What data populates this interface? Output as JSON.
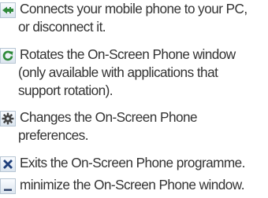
{
  "items": [
    {
      "icon": "connect-icon",
      "lines": [
        "Connects your mobile phone to your PC,",
        "or disconnect it."
      ]
    },
    {
      "icon": "rotate-icon",
      "lines": [
        "Rotates the On-Screen Phone window",
        "(only available with applications that",
        "support rotation)."
      ]
    },
    {
      "icon": "gear-icon",
      "lines": [
        "Changes the On-Screen Phone",
        "preferences."
      ]
    },
    {
      "icon": "close-icon",
      "lines": [
        "Exits the On-Screen Phone programme."
      ]
    },
    {
      "icon": "minimize-icon",
      "lines": [
        "minimize the On-Screen Phone window."
      ]
    }
  ]
}
